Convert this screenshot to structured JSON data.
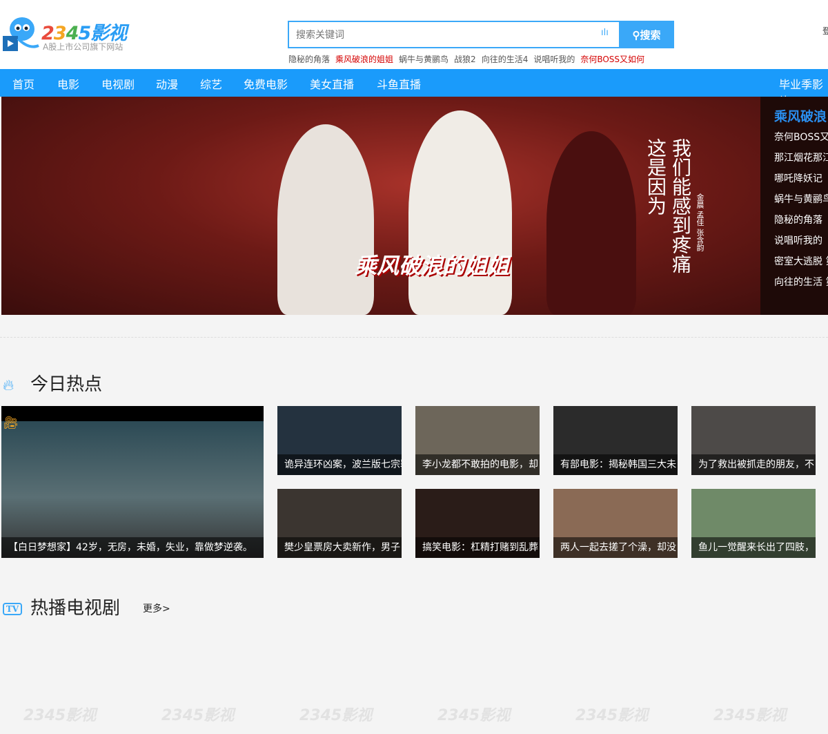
{
  "logo": {
    "brand": "2345影视",
    "subtitle": "A股上市公司旗下网站"
  },
  "search": {
    "placeholder": "搜索关键词",
    "button": "搜索"
  },
  "hotwords": [
    "隐秘的角落",
    "乘风破浪的姐姐",
    "蜗牛与黄鹂鸟",
    "战狼2",
    "向往的生活4",
    "说唱听我的",
    "奈何BOSS又如何"
  ],
  "login": "登",
  "nav": [
    "首页",
    "电影",
    "电视剧",
    "动漫",
    "综艺",
    "免费电影",
    "美女直播",
    "斗鱼直播"
  ],
  "nav_right": "毕业季影片",
  "banner": {
    "title": "乘风破浪的姐姐",
    "poem": "我们能感到疼痛 这是因为",
    "names": "金晨 孟佳 张含韵"
  },
  "side": {
    "heading": "乘风破浪",
    "items": [
      "奈何BOSS又",
      "那江烟花那江",
      "哪吒降妖记",
      "蜗牛与黄鹂鸟",
      "隐秘的角落",
      "说唱听我的",
      "密室大逃脱 第",
      "向往的生活 第"
    ]
  },
  "sections": {
    "hot": "今日热点",
    "tv": "热播电视剧",
    "more": "更多>"
  },
  "hot_cards": [
    "【白日梦想家】42岁，无房，未婚，失业，靠做梦逆袭。",
    "诡异连环凶案，波兰版七宗罪",
    "李小龙都不敢拍的电影，却",
    "有部电影：揭秘韩国三大未",
    "为了救出被抓走的朋友，不",
    "樊少皇票房大卖新作，男子",
    "搞笑电影：杠精打赌到乱葬",
    "两人一起去搓了个澡，却没",
    "鱼儿一觉醒来长出了四肢，"
  ],
  "watermark": "2345影视"
}
